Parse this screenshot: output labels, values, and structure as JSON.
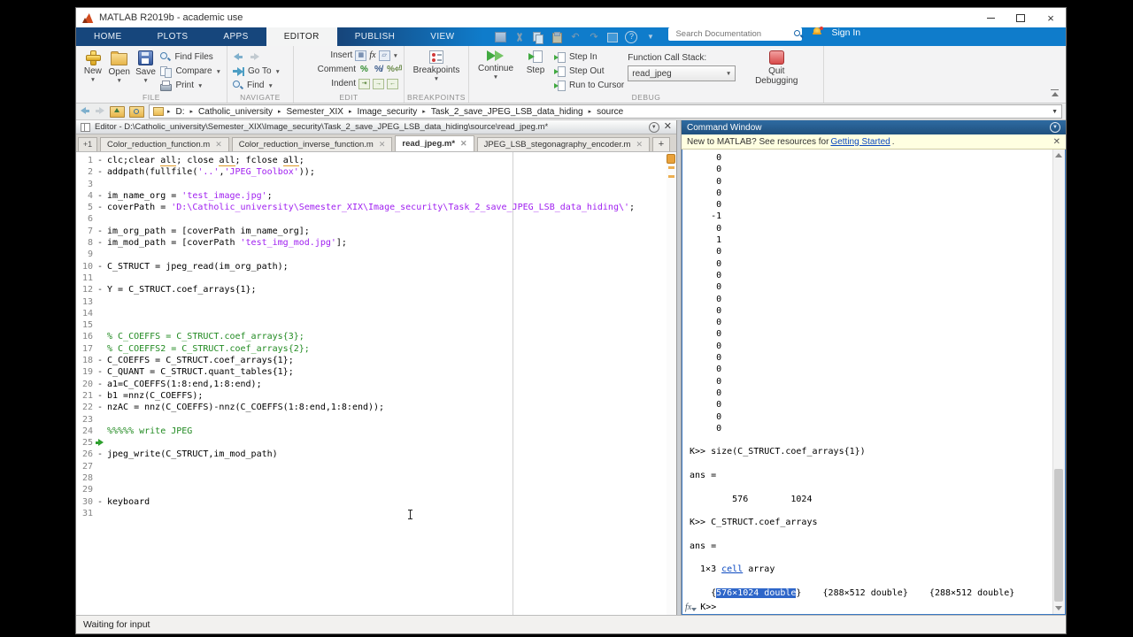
{
  "colors": {
    "ribbon_blue_dark": "#16467C",
    "ribbon_blue_light": "#0F7CCB",
    "string_purple": "#A020F0",
    "comment_green": "#228B22",
    "selection_blue": "#2E66C9",
    "banner_yellow": "#FFFFE1",
    "cmd_header_blue": "#24598A",
    "debug_green": "#2EA02E",
    "quit_red": "#D84B4B"
  },
  "window": {
    "title": "MATLAB R2019b - academic use"
  },
  "ribbon": {
    "tabs": [
      {
        "label": "HOME",
        "active": false
      },
      {
        "label": "PLOTS",
        "active": false
      },
      {
        "label": "APPS",
        "active": false
      },
      {
        "label": "EDITOR",
        "active": true
      },
      {
        "label": "PUBLISH",
        "active": false
      },
      {
        "label": "VIEW",
        "active": false
      }
    ],
    "search": {
      "placeholder": "Search Documentation"
    },
    "signin_label": "Sign In",
    "file": {
      "section": "FILE",
      "new_label": "New",
      "open_label": "Open",
      "save_label": "Save",
      "find_files_label": "Find Files",
      "compare_label": "Compare",
      "print_label": "Print"
    },
    "navigate": {
      "section": "NAVIGATE",
      "goto_label": "Go To",
      "find_label": "Find"
    },
    "edit": {
      "section": "EDIT",
      "insert_label": "Insert",
      "comment_label": "Comment",
      "indent_label": "Indent"
    },
    "breakpoints": {
      "section": "BREAKPOINTS",
      "label": "Breakpoints"
    },
    "debug": {
      "section": "DEBUG",
      "continue_label": "Continue",
      "step_label": "Step",
      "step_in_label": "Step In",
      "step_out_label": "Step Out",
      "run_to_cursor_label": "Run to Cursor",
      "stack_label": "Function Call Stack:",
      "stack_value": "read_jpeg",
      "quit_line1": "Quit",
      "quit_line2": "Debugging"
    }
  },
  "address": {
    "segments": [
      "D:",
      "Catholic_university",
      "Semester_XIX",
      "Image_security",
      "Task_2_save_JPEG_LSB_data_hiding",
      "source"
    ]
  },
  "editor": {
    "title": "Editor - D:\\Catholic_university\\Semester_XIX\\Image_security\\Task_2_save_JPEG_LSB_data_hiding\\source\\read_jpeg.m*",
    "tab_overflow": "+1",
    "tabs": [
      {
        "label": "Color_reduction_function.m",
        "active": false
      },
      {
        "label": "Color_reduction_inverse_function.m",
        "active": false
      },
      {
        "label": "read_jpeg.m*",
        "active": true
      },
      {
        "label": "JPEG_LSB_stegonagraphy_encoder.m",
        "active": false
      }
    ],
    "code_lines": [
      {
        "n": 1,
        "m": "-",
        "seg": [
          [
            "clc;clear ",
            "d"
          ],
          [
            "all",
            "w"
          ],
          [
            "; close ",
            "d"
          ],
          [
            "all",
            "w"
          ],
          [
            "; fclose ",
            "d"
          ],
          [
            "all",
            "w"
          ],
          [
            ";",
            "d"
          ]
        ]
      },
      {
        "n": 2,
        "m": "-",
        "seg": [
          [
            "addpath(fullfile(",
            "d"
          ],
          [
            "'..'",
            "s"
          ],
          [
            ",",
            "d"
          ],
          [
            "'JPEG_Toolbox'",
            "s"
          ],
          [
            "));",
            "d"
          ]
        ]
      },
      {
        "n": 3,
        "m": "",
        "seg": []
      },
      {
        "n": 4,
        "m": "-",
        "seg": [
          [
            "im_name_org = ",
            "d"
          ],
          [
            "'test_image.jpg'",
            "s"
          ],
          [
            ";",
            "d"
          ]
        ]
      },
      {
        "n": 5,
        "m": "-",
        "seg": [
          [
            "coverPath = ",
            "d"
          ],
          [
            "'D:\\Catholic_university\\Semester_XIX\\Image_security\\Task_2_save_JPEG_LSB_data_hiding\\'",
            "s"
          ],
          [
            ";",
            "d"
          ]
        ]
      },
      {
        "n": 6,
        "m": "",
        "seg": []
      },
      {
        "n": 7,
        "m": "-",
        "seg": [
          [
            "im_org_path = [coverPath im_name_org];",
            "d"
          ]
        ]
      },
      {
        "n": 8,
        "m": "-",
        "seg": [
          [
            "im_mod_path = [coverPath ",
            "d"
          ],
          [
            "'test_img_mod.jpg'",
            "s"
          ],
          [
            "];",
            "d"
          ]
        ]
      },
      {
        "n": 9,
        "m": "",
        "seg": []
      },
      {
        "n": 10,
        "m": "-",
        "seg": [
          [
            "C_STRUCT = jpeg_read(im_org_path);",
            "d"
          ]
        ]
      },
      {
        "n": 11,
        "m": "",
        "seg": []
      },
      {
        "n": 12,
        "m": "-",
        "seg": [
          [
            "Y = C_STRUCT.coef_arrays{1};",
            "d"
          ]
        ]
      },
      {
        "n": 13,
        "m": "",
        "seg": []
      },
      {
        "n": 14,
        "m": "",
        "seg": []
      },
      {
        "n": 15,
        "m": "",
        "seg": []
      },
      {
        "n": 16,
        "m": "",
        "seg": [
          [
            "% C_COEFFS = C_STRUCT.coef_arrays{3};",
            "c"
          ]
        ]
      },
      {
        "n": 17,
        "m": "",
        "seg": [
          [
            "% C_COEFFS2 = C_STRUCT.coef_arrays{2};",
            "c"
          ]
        ]
      },
      {
        "n": 18,
        "m": "-",
        "seg": [
          [
            "C_COEFFS = C_STRUCT.coef_arrays{1};",
            "d"
          ]
        ]
      },
      {
        "n": 19,
        "m": "-",
        "seg": [
          [
            "C_QUANT = C_STRUCT.quant_tables{1};",
            "d"
          ]
        ]
      },
      {
        "n": 20,
        "m": "-",
        "seg": [
          [
            "a1=C_COEFFS(1:8:end,1:8:end);",
            "d"
          ]
        ]
      },
      {
        "n": 21,
        "m": "-",
        "seg": [
          [
            "b1 =nnz(C_COEFFS);",
            "d"
          ]
        ]
      },
      {
        "n": 22,
        "m": "-",
        "seg": [
          [
            "nzAC = nnz(C_COEFFS)-nnz(C_COEFFS(1:8:end,1:8:end));",
            "d"
          ]
        ]
      },
      {
        "n": 23,
        "m": "",
        "seg": []
      },
      {
        "n": 24,
        "m": "",
        "seg": [
          [
            "%%%%% write JPEG",
            "c"
          ]
        ]
      },
      {
        "n": 25,
        "m": "a",
        "seg": []
      },
      {
        "n": 26,
        "m": "-",
        "seg": [
          [
            "jpeg_write(C_STRUCT,im_mod_path)",
            "d"
          ]
        ]
      },
      {
        "n": 27,
        "m": "",
        "seg": []
      },
      {
        "n": 28,
        "m": "",
        "seg": []
      },
      {
        "n": 29,
        "m": "",
        "seg": []
      },
      {
        "n": 30,
        "m": "-",
        "seg": [
          [
            "keyboard",
            "d"
          ]
        ]
      },
      {
        "n": 31,
        "m": "",
        "seg": []
      }
    ]
  },
  "command_window": {
    "title": "Command Window",
    "banner": {
      "prefix": "New to MATLAB? See resources for ",
      "link": "Getting Started",
      "suffix": "."
    },
    "output_numbers": [
      "     0",
      "     0",
      "     0",
      "     0",
      "     0",
      "    -1",
      "     0",
      "     1",
      "     0",
      "     0",
      "     0",
      "     0",
      "     0",
      "     0",
      "     0",
      "     0",
      "     0",
      "     0",
      "     0",
      "     0",
      "     0",
      "     0",
      "     0",
      "     0"
    ],
    "lines": [
      [],
      [
        [
          "K>> size(C_STRUCT.coef_arrays{1})",
          "d"
        ]
      ],
      [],
      [
        [
          "ans =",
          "d"
        ]
      ],
      [],
      [
        [
          "        576        1024",
          "d"
        ]
      ],
      [],
      [
        [
          "K>> C_STRUCT.coef_arrays",
          "d"
        ]
      ],
      [],
      [
        [
          "ans =",
          "d"
        ]
      ],
      [],
      [
        [
          "  1×3 ",
          "d"
        ],
        [
          "cell",
          "l"
        ],
        [
          " array",
          "d"
        ]
      ],
      [],
      [
        [
          "    {",
          "d"
        ],
        [
          "576×1024 double",
          "sel"
        ],
        [
          "}    {288×512 double}    {288×512 double}",
          "d"
        ]
      ]
    ],
    "fx_label": "fx",
    "prompt": "K>>"
  },
  "status": {
    "text": "Waiting for input"
  }
}
